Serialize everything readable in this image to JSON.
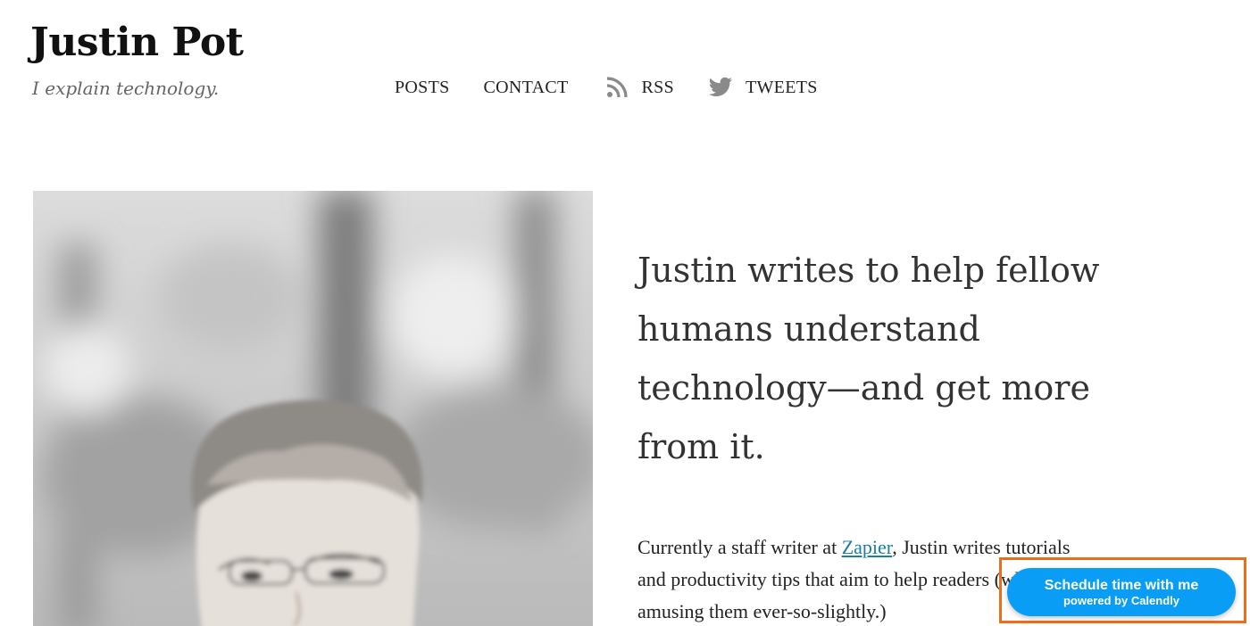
{
  "header": {
    "title": "Justin Pot",
    "tagline": "I explain technology."
  },
  "nav": {
    "items": [
      {
        "label": "POSTS",
        "icon": ""
      },
      {
        "label": "CONTACT",
        "icon": ""
      },
      {
        "label": "RSS",
        "icon": "rss-icon"
      },
      {
        "label": "TWEETS",
        "icon": "twitter-bird-icon"
      }
    ]
  },
  "main": {
    "photo_alt": "Portrait of Justin Pot",
    "headline": "Justin writes to help fellow humans understand technology—and get more from it.",
    "bio": {
      "before_link": "Currently a staff writer at ",
      "link_text": "Zapier",
      "after_link": ", Justin writes tutorials and productivity tips that aim to help readers (while amusing them ever-so-slightly.)"
    }
  },
  "calendly": {
    "main_label": "Schedule time with me",
    "sub_label": "powered by Calendly"
  },
  "colors": {
    "link": "#1a7fa1",
    "calendly_blue": "#0a9df5",
    "highlight_orange": "#ef6c1a",
    "icon_gray": "#8a8a8a"
  }
}
